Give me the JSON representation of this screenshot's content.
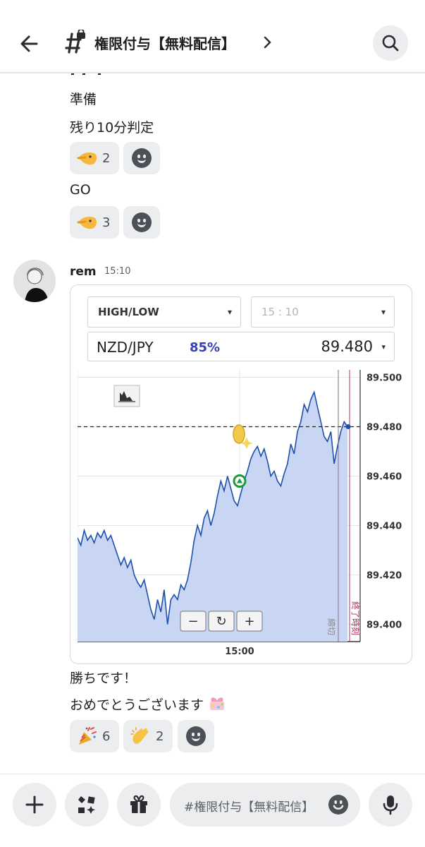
{
  "header": {
    "channel_name": "権限付与【無料配信】",
    "chevron": "›"
  },
  "messages_top": {
    "line_1": "準備",
    "line_2": "残り10分判定",
    "reaction_1_count": "2",
    "line_3": "GO",
    "reaction_2_count": "3"
  },
  "post": {
    "author": "rem",
    "time": "15:10",
    "text_1": "勝ちです！",
    "text_2": "おめでとうございます",
    "reactions": [
      {
        "emoji": "party-popper",
        "count": "6"
      },
      {
        "emoji": "clapping-hands",
        "count": "2"
      }
    ]
  },
  "trade_panel": {
    "type_label": "HIGH/LOW",
    "time_label": "15 : 10",
    "pair": "NZD/JPY",
    "payout": "85%",
    "rate": "89.480",
    "caret": "▾",
    "zoom_out": "−",
    "zoom_reset": "↻",
    "zoom_in": "+",
    "cutoff_label": "締切",
    "end_label": "終了時刻"
  },
  "chart_data": {
    "type": "area",
    "x_tick_labels": [
      "15:00"
    ],
    "y_tick_labels": [
      "89.500",
      "89.480",
      "89.460",
      "89.440",
      "89.420",
      "89.400"
    ],
    "ylim": [
      89.393,
      89.503
    ],
    "entry_level": 89.48,
    "entry_marker": "up-triangle",
    "series": [
      {
        "values": [
          89.435,
          89.432,
          89.438,
          89.434,
          89.436,
          89.433,
          89.437,
          89.435,
          89.438,
          89.434,
          89.436,
          89.432,
          89.428,
          89.424,
          89.427,
          89.423,
          89.426,
          89.42,
          89.417,
          89.415,
          89.418,
          89.412,
          89.406,
          89.402,
          89.41,
          89.405,
          89.414,
          89.4,
          89.41,
          89.412,
          89.41,
          89.416,
          89.414,
          89.418,
          89.425,
          89.434,
          89.44,
          89.436,
          89.443,
          89.446,
          89.44,
          89.445,
          89.452,
          89.458,
          89.454,
          89.46,
          89.455,
          89.45,
          89.448,
          89.453,
          89.458,
          89.462,
          89.467,
          89.47,
          89.472,
          89.468,
          89.471,
          89.466,
          89.46,
          89.462,
          89.458,
          89.456,
          89.461,
          89.465,
          89.473,
          89.469,
          89.478,
          89.482,
          89.489,
          89.486,
          89.491,
          89.494,
          89.488,
          89.482,
          89.476,
          89.474,
          89.478,
          89.465,
          89.472,
          89.478,
          89.482,
          89.48
        ]
      }
    ],
    "grid": true
  }
}
